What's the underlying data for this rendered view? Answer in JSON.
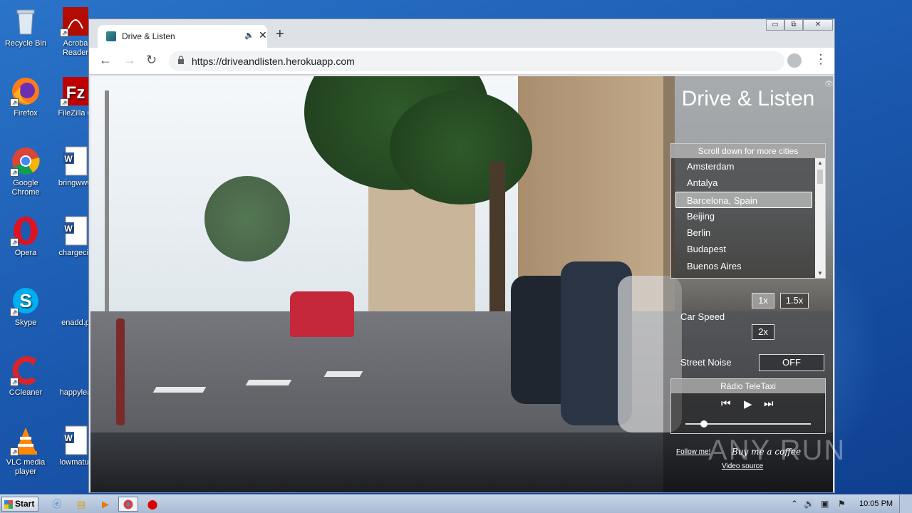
{
  "desktop": {
    "icons": [
      {
        "label": "Recycle Bin",
        "icon": "recycle-bin-icon"
      },
      {
        "label": "Acroba Reader",
        "icon": "acrobat-reader-icon"
      },
      {
        "label": "Firefox",
        "icon": "firefox-icon"
      },
      {
        "label": "FileZilla C",
        "icon": "filezilla-icon"
      },
      {
        "label": "Google Chrome",
        "icon": "chrome-icon"
      },
      {
        "label": "bringwww",
        "icon": "word-doc-icon"
      },
      {
        "label": "Opera",
        "icon": "opera-icon"
      },
      {
        "label": "chargeciv",
        "icon": "word-doc-icon"
      },
      {
        "label": "Skype",
        "icon": "skype-icon"
      },
      {
        "label": "enadd.p",
        "icon": "document-icon"
      },
      {
        "label": "CCleaner",
        "icon": "ccleaner-icon"
      },
      {
        "label": "happylea",
        "icon": "document-icon"
      },
      {
        "label": "VLC media player",
        "icon": "vlc-icon"
      },
      {
        "label": "lowmatur",
        "icon": "word-doc-icon"
      }
    ]
  },
  "browser": {
    "tab_title": "Drive & Listen",
    "audio_indicator": "🔈",
    "close_glyph": "✕",
    "new_tab_glyph": "+",
    "url": "https://driveandlisten.herokuapp.com",
    "window_controls": [
      "▭",
      "⧉",
      "✕"
    ]
  },
  "app": {
    "title": "Drive & Listen",
    "city_hint": "Scroll down for more cities",
    "cities": [
      "Amsterdam",
      "Antalya",
      "Barcelona, Spain",
      "Beijing",
      "Berlin",
      "Budapest",
      "Buenos Aires"
    ],
    "selected_city": "Barcelona, Spain",
    "car_speed_label": "Car Speed",
    "speeds": [
      "1x",
      "1.5x",
      "2x"
    ],
    "active_speed": "1x",
    "street_noise_label": "Street Noise",
    "street_noise_value": "OFF",
    "radio_name": "Rádio TeleTaxi",
    "radio_volume": 0.15,
    "follow_link": "Follow me!",
    "coffee_link": "Buy me a coffee",
    "video_source_link": "Video source"
  },
  "watermark": "ANY RUN",
  "taskbar": {
    "start_label": "Start",
    "clock": "10:05 PM"
  }
}
